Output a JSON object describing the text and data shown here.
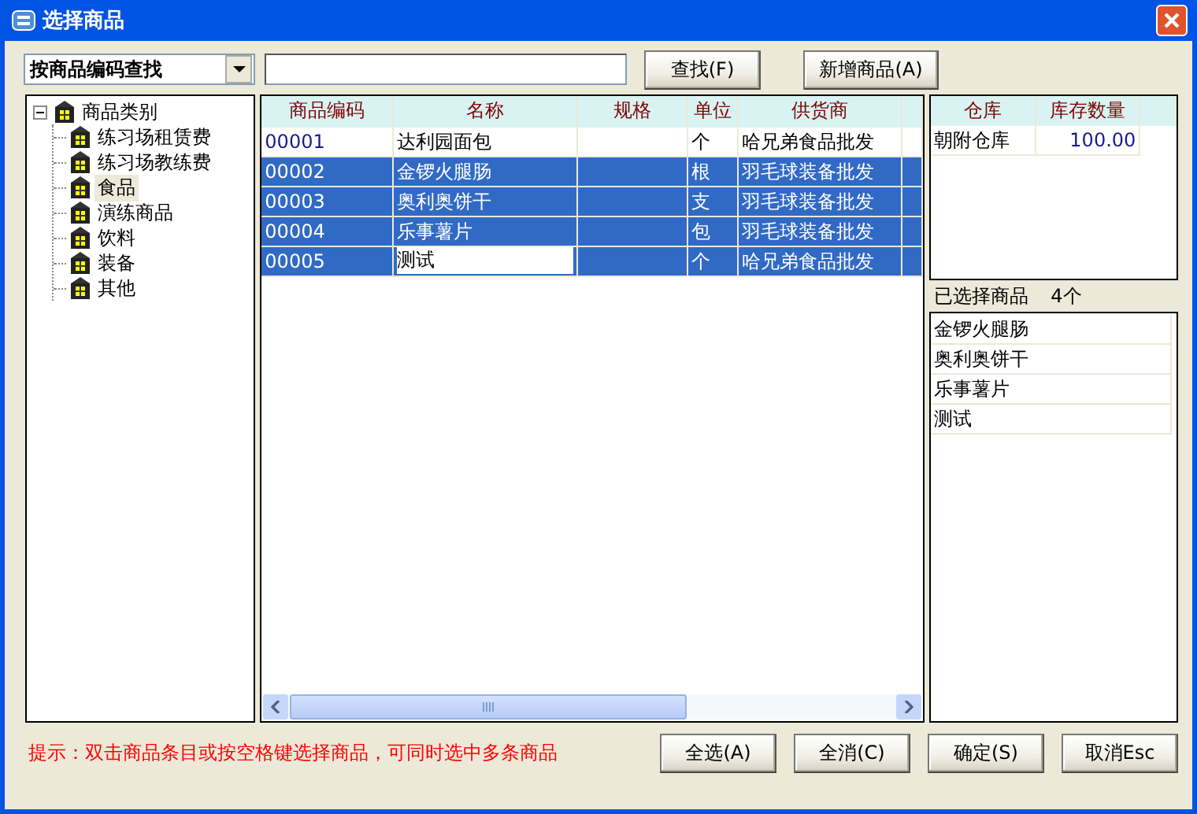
{
  "window": {
    "title": "选择商品"
  },
  "search": {
    "mode": "按商品编码查找",
    "buttons": [
      "查找(F)",
      "新增商品(A)"
    ]
  },
  "tree": {
    "label": "商品类别",
    "expanded": true,
    "children": [
      {
        "label": "练习场租赁费",
        "selected": false
      },
      {
        "label": "练习场教练费",
        "selected": false
      },
      {
        "label": "食品",
        "selected": true
      },
      {
        "label": "演练商品",
        "selected": false
      },
      {
        "label": "饮料",
        "selected": false
      },
      {
        "label": "装备",
        "selected": false
      },
      {
        "label": "其他",
        "selected": false
      }
    ]
  },
  "grid": {
    "columns": [
      "商品编码",
      "名称",
      "规格",
      "单位",
      "供货商"
    ],
    "rows": [
      {
        "code": "00001",
        "name": "达利园面包",
        "unit": "个",
        "supplier": "哈兄弟食品批发",
        "selected": false,
        "editing": false
      },
      {
        "code": "00002",
        "name": "金锣火腿肠",
        "unit": "根",
        "supplier": "羽毛球装备批发",
        "selected": true,
        "editing": false
      },
      {
        "code": "00003",
        "name": "奥利奥饼干",
        "unit": "支",
        "supplier": "羽毛球装备批发",
        "selected": true,
        "editing": false
      },
      {
        "code": "00004",
        "name": "乐事薯片",
        "unit": "包",
        "supplier": "羽毛球装备批发",
        "selected": true,
        "editing": false
      },
      {
        "code": "00005",
        "name": "测试",
        "unit": "个",
        "supplier": "哈兄弟食品批发",
        "selected": true,
        "editing": true
      }
    ]
  },
  "stock": {
    "columns": [
      "仓库",
      "库存数量"
    ],
    "rows": [
      {
        "warehouse": "朝附仓库",
        "quantity": "100.00"
      }
    ]
  },
  "chosen": {
    "label": "已选择商品",
    "count": "4个",
    "items": [
      "金锣火腿肠",
      "奥利奥饼干",
      "乐事薯片",
      "测试"
    ]
  },
  "hint": "提示：双击商品条目或按空格键选择商品，可同时选中多条商品",
  "footer_buttons": [
    "全选(A)",
    "全消(C)",
    "确定(S)",
    "取消Esc"
  ]
}
